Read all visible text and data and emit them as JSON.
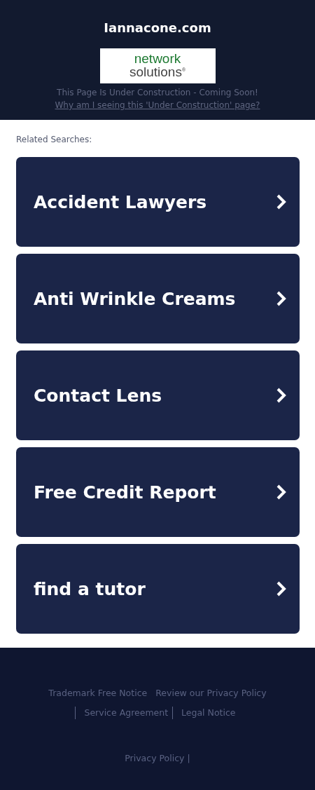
{
  "header": {
    "domain": "Iannacone.com",
    "logo": {
      "line_1": "network",
      "line_2": "solutions",
      "mark": "®"
    },
    "notice": "This Page Is Under Construction - Coming Soon!",
    "link": "Why am I seeing this 'Under Construction' page?"
  },
  "related": {
    "title": "Related Searches:",
    "items": [
      {
        "label": "Accident Lawyers"
      },
      {
        "label": "Anti Wrinkle Creams"
      },
      {
        "label": "Contact Lens"
      },
      {
        "label": "Free Credit Report"
      },
      {
        "label": "find a tutor"
      }
    ]
  },
  "footer": {
    "links": [
      {
        "label": "Trademark Free Notice",
        "divider_before": false
      },
      {
        "label": "Review our Privacy Policy",
        "divider_before": false
      },
      {
        "label": "Service Agreement",
        "divider_before": true
      },
      {
        "label": "Legal Notice",
        "divider_before": true
      }
    ],
    "bottom_link": "Privacy Policy",
    "bottom_separator": "|"
  }
}
